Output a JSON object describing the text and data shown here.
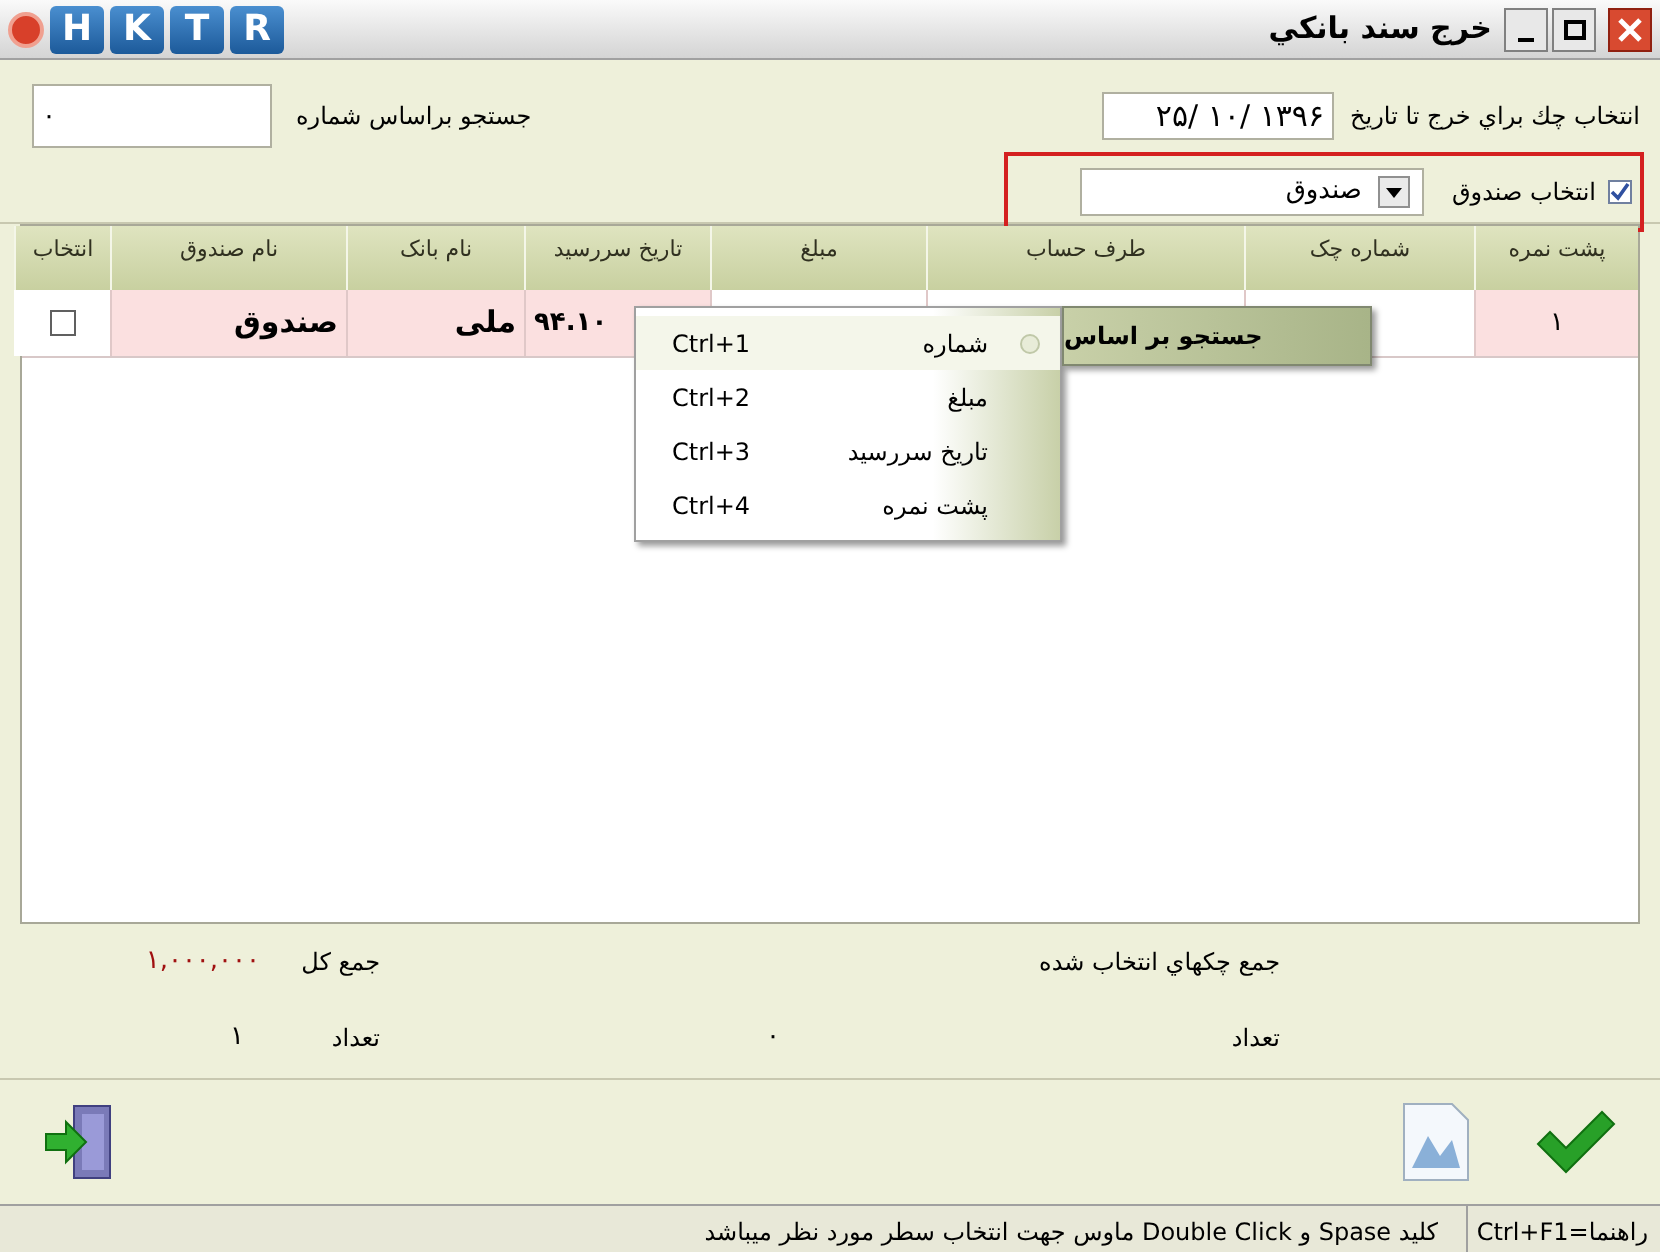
{
  "window": {
    "title": "خرج سند بانکي",
    "toolbar_buttons": [
      "R",
      "T",
      "K",
      "H"
    ]
  },
  "filters": {
    "date_label": "انتخاب چك براي خرج تا تاريخ",
    "date_value": "۱۳۹۶ /۱۰ /۲۵",
    "search_label": "جستجو براساس شماره",
    "search_value": "۰",
    "fund_checkbox": {
      "label": "انتخاب صندوق",
      "checked": true
    },
    "fund_combo": {
      "value": "صندوق"
    }
  },
  "table": {
    "columns": [
      "پشت نمره",
      "شماره چک",
      "طرف حساب",
      "مبلغ",
      "تاریخ سررسید",
      "نام بانک",
      "نام صندوق",
      "انتخاب"
    ],
    "rows": [
      {
        "back_number": "۱",
        "due_date": "۹۴.۱۰",
        "bank": "ملی",
        "fund": "صندوق",
        "checked": false,
        "selected": true
      }
    ]
  },
  "context_menu": {
    "submenu": {
      "label": "جستجو بر اساس",
      "selected": true
    },
    "items": [
      {
        "label": "شماره",
        "shortcut": "Ctrl+1",
        "selected": true
      },
      {
        "label": "مبلغ",
        "shortcut": "Ctrl+2",
        "selected": false
      },
      {
        "label": "تاریخ سررسید",
        "shortcut": "Ctrl+3",
        "selected": false
      },
      {
        "label": "پشت نمره",
        "shortcut": "Ctrl+4",
        "selected": false
      }
    ]
  },
  "summary": {
    "selected_total_label": "جمع چکهاي انتخاب شده",
    "selected_count_label": "تعداد",
    "selected_count": "۰",
    "total_label": "جمع کل",
    "total_value": "۱,۰۰۰,۰۰۰",
    "total_count_label": "تعداد",
    "total_count": "۱"
  },
  "status_bar": {
    "help": "راهنما=Ctrl+F1",
    "hint": "کلید Spase و Double Click ماوس جهت انتخاب سطر مورد نظر میباشد"
  }
}
